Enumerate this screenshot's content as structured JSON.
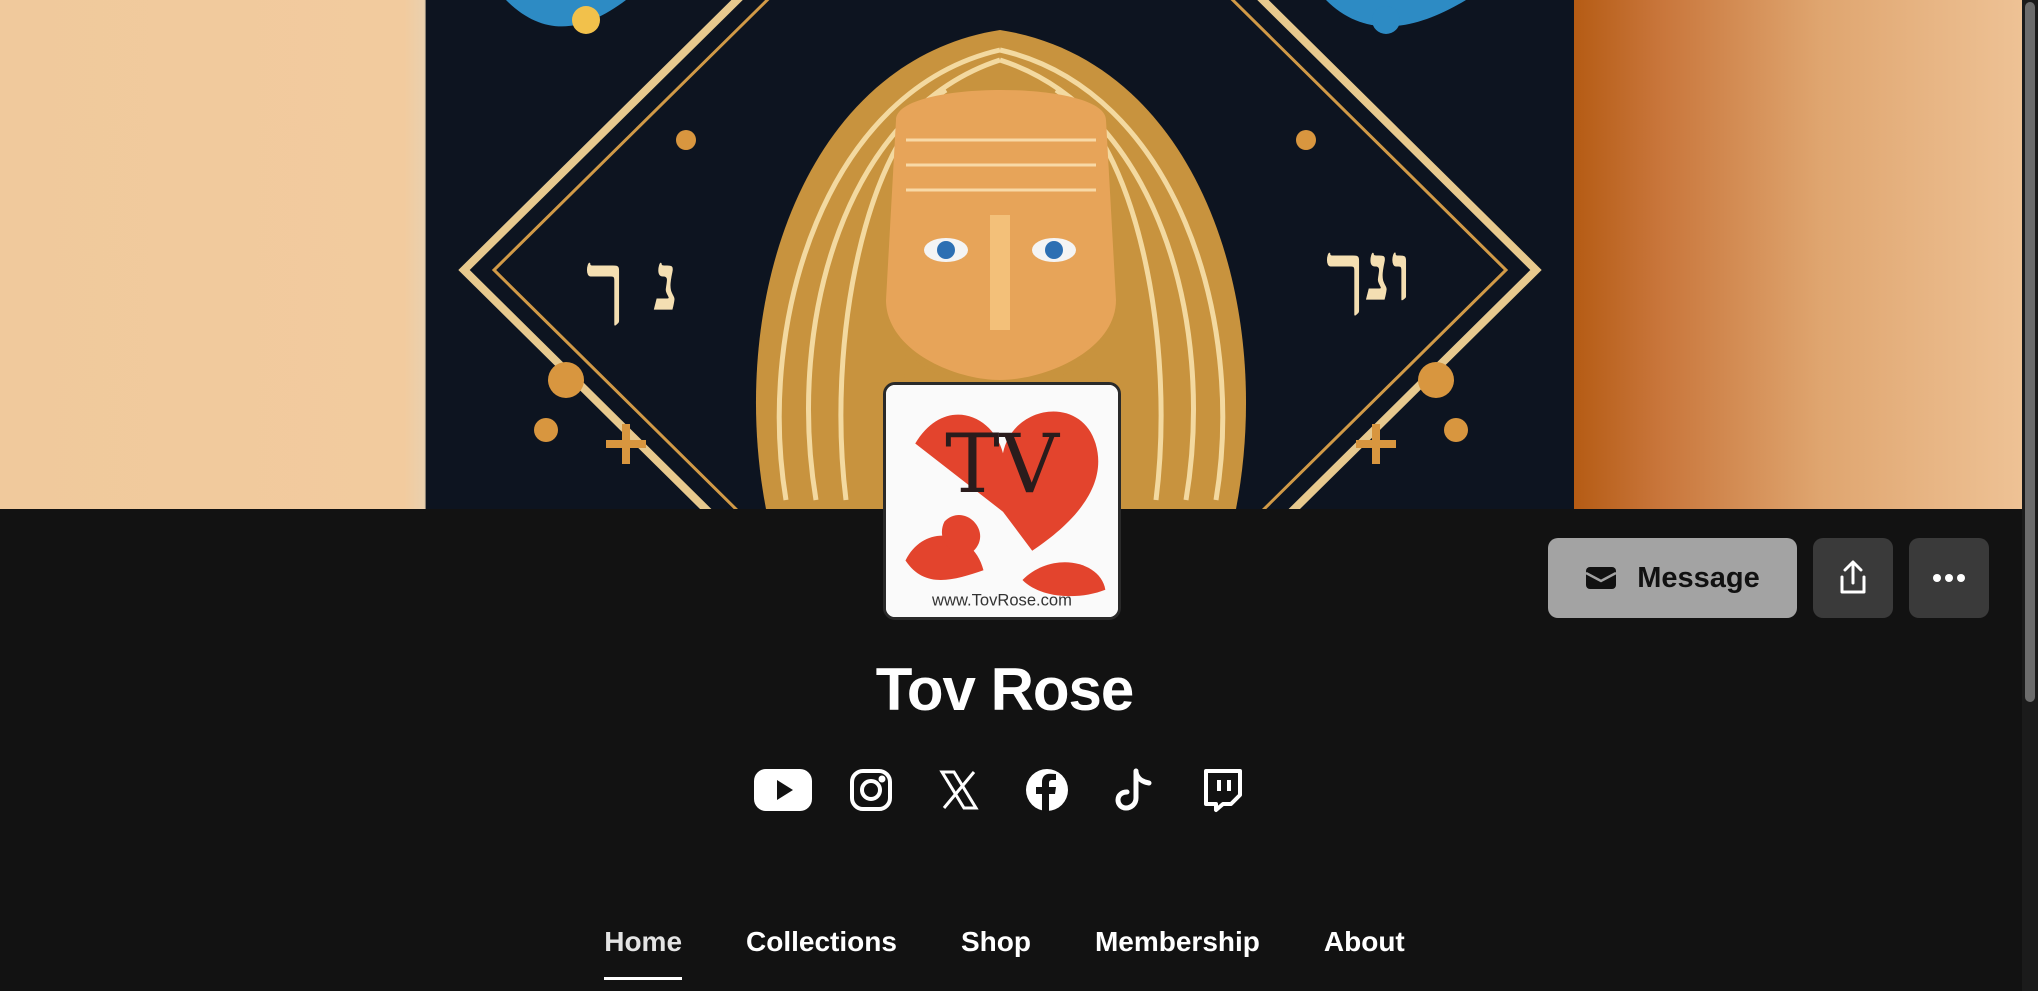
{
  "profile": {
    "name": "Tov Rose",
    "avatar_text": "www.TovRose.com",
    "avatar_monogram": "TV"
  },
  "actions": {
    "message_label": "Message"
  },
  "socials": [
    {
      "icon": "youtube-icon"
    },
    {
      "icon": "instagram-icon"
    },
    {
      "icon": "x-icon"
    },
    {
      "icon": "facebook-icon"
    },
    {
      "icon": "tiktok-icon"
    },
    {
      "icon": "twitch-icon"
    }
  ],
  "tabs": [
    {
      "label": "Home",
      "active": true
    },
    {
      "label": "Collections",
      "active": false
    },
    {
      "label": "Shop",
      "active": false
    },
    {
      "label": "Membership",
      "active": false
    },
    {
      "label": "About",
      "active": false
    }
  ],
  "colors": {
    "background": "#121212",
    "message_button": "#a3a3a3",
    "icon_button": "#3a3a3a",
    "accent_red": "#e3442d"
  }
}
